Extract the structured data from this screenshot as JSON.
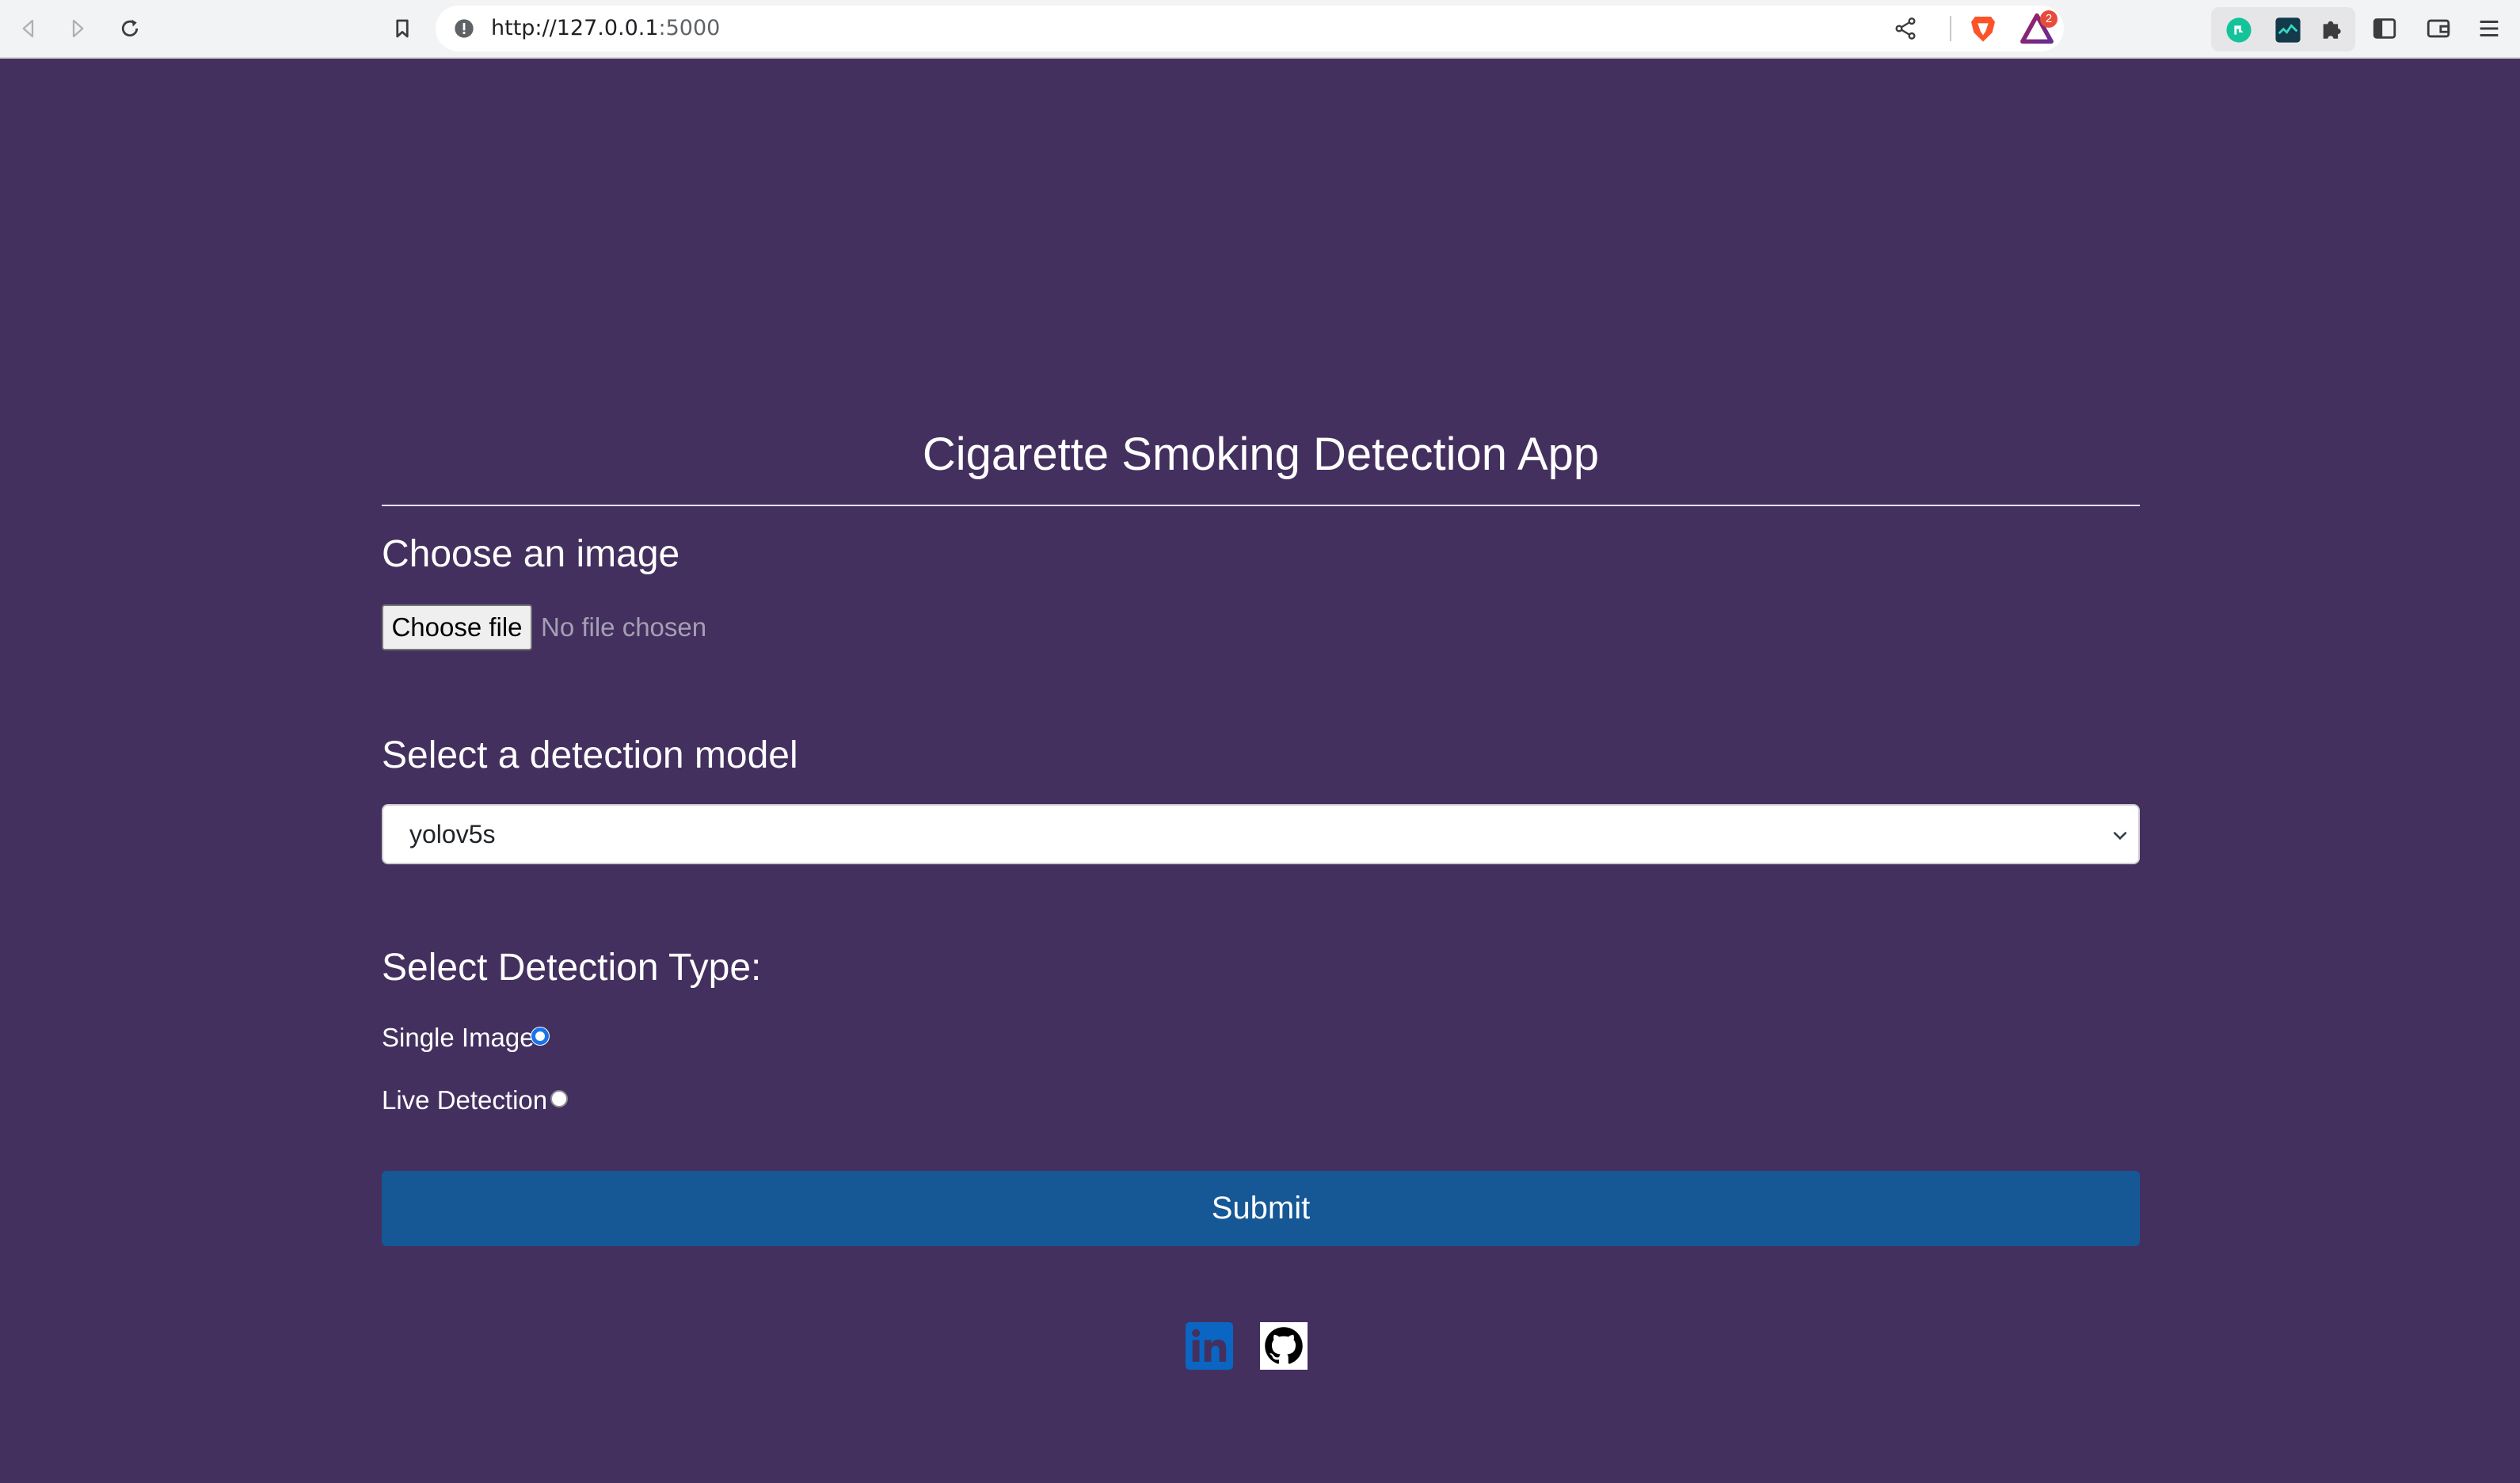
{
  "browser": {
    "url_host": "http://127.0.0.1",
    "url_port": ":5000",
    "rewards_badge": "2"
  },
  "page": {
    "title": "Cigarette Smoking Detection App",
    "image_section": {
      "heading": "Choose an image",
      "file_button_label": "Choose file",
      "file_status": "No file chosen"
    },
    "model_section": {
      "heading": "Select a detection model",
      "selected_model": "yolov5s"
    },
    "detection_type": {
      "heading": "Select Detection Type:",
      "options": [
        {
          "label": "Single Image",
          "checked": true
        },
        {
          "label": "Live Detection",
          "checked": false
        }
      ]
    },
    "submit_label": "Submit"
  },
  "colors": {
    "page_background": "#43305f",
    "submit_button": "#155895",
    "linkedin": "#0a66c2",
    "github": "#000000"
  },
  "icons": {
    "toolbar": [
      "back-icon",
      "forward-icon",
      "reload-icon",
      "bookmark-icon"
    ],
    "urlbar": [
      "site-info-icon",
      "share-icon",
      "brave-shields-icon",
      "brave-rewards-icon"
    ],
    "extensions": [
      "grammarly-icon",
      "extension-icon",
      "puzzle-icon",
      "sidebar-icon",
      "wallet-icon",
      "menu-icon"
    ],
    "footer": [
      "linkedin-icon",
      "github-icon"
    ]
  }
}
